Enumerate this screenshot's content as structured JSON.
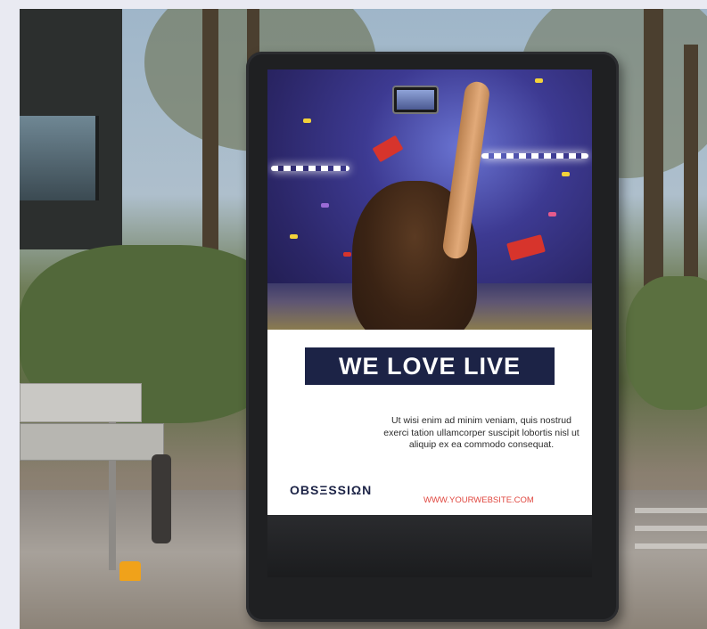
{
  "poster": {
    "headline": "WE LOVE LIVE",
    "body": "Ut wisi enim ad minim veniam, quis nostrud exerci tation ullamcorper suscipit lobortis nisl ut aliquip ex ea commodo consequat.",
    "brand": "OBSΞSSIΩN",
    "url": "WWW.YOURWEBSITE.COM"
  },
  "colors": {
    "headline_bg": "#1c2346",
    "url_text": "#e0473f"
  }
}
